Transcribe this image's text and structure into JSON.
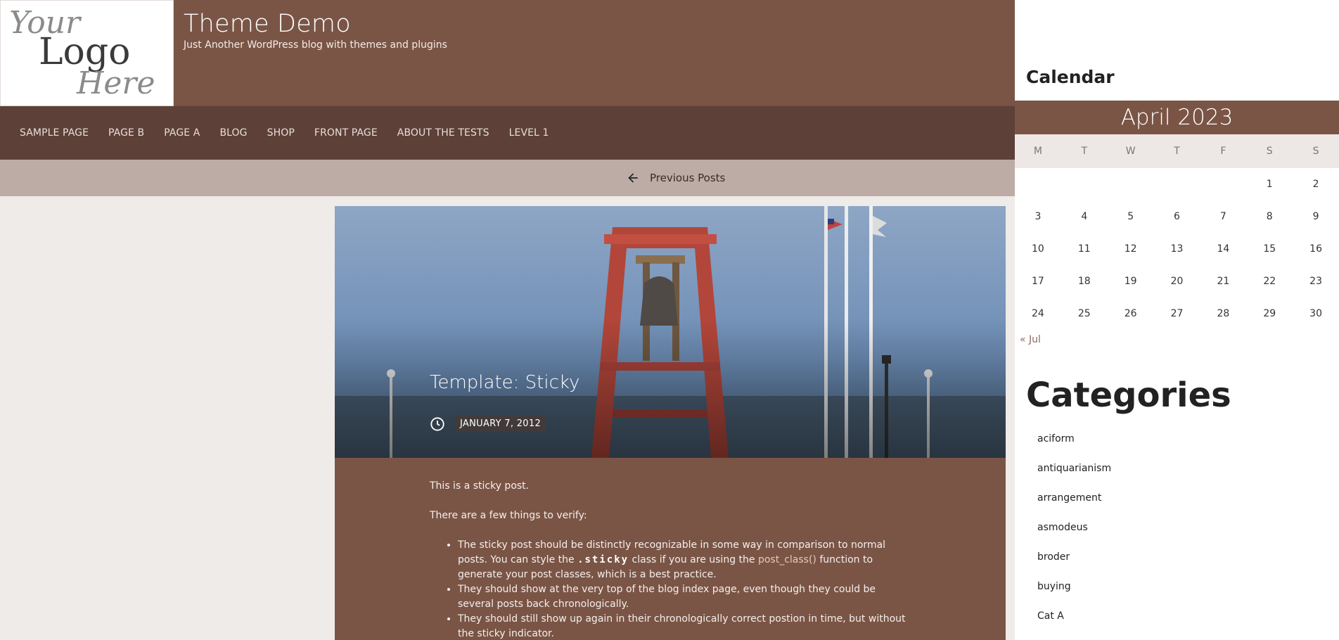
{
  "header": {
    "logo_lines": [
      "Your",
      "Logo",
      "Here"
    ],
    "site_title": "Theme Demo",
    "site_description": "Just Another WordPress blog with themes and plugins"
  },
  "nav": {
    "items": [
      "SAMPLE PAGE",
      "PAGE B",
      "PAGE A",
      "BLOG",
      "SHOP",
      "FRONT PAGE",
      "ABOUT THE TESTS",
      "LEVEL 1"
    ]
  },
  "pagination": {
    "previous_label": "Previous Posts"
  },
  "post": {
    "title": "Template: Sticky",
    "date": "JANUARY 7, 2012",
    "paragraphs": [
      "This is a sticky post.",
      "There are a few things to verify:"
    ],
    "list": {
      "item1_before": "The sticky post should be distinctly recognizable in some way in comparison to normal posts. You can style the ",
      "item1_code": ".sticky",
      "item1_middle": " class if you are using the ",
      "item1_link": "post_class()",
      "item1_after": " function to generate your post classes, which is a best practice.",
      "item2": "They should show at the very top of the blog index page, even though they could be several posts back chronologically.",
      "item3": "They should still show up again in their chronologically correct postion in time, but without the sticky indicator."
    }
  },
  "sidebar": {
    "calendar": {
      "title": "Calendar",
      "month": "April 2023",
      "weekdays": [
        "M",
        "T",
        "W",
        "T",
        "F",
        "S",
        "S"
      ],
      "weeks": [
        [
          "",
          "",
          "",
          "",
          "",
          "1",
          "2"
        ],
        [
          "3",
          "4",
          "5",
          "6",
          "7",
          "8",
          "9"
        ],
        [
          "10",
          "11",
          "12",
          "13",
          "14",
          "15",
          "16"
        ],
        [
          "17",
          "18",
          "19",
          "20",
          "21",
          "22",
          "23"
        ],
        [
          "24",
          "25",
          "26",
          "27",
          "28",
          "29",
          "30"
        ]
      ],
      "prev_link": "« Jul"
    },
    "categories": {
      "title": "Categories",
      "items": [
        "aciform",
        "antiquarianism",
        "arrangement",
        "asmodeus",
        "broder",
        "buying",
        "Cat A"
      ]
    }
  },
  "colors": {
    "brand_brown": "#7a5546",
    "nav_dark": "#5d4037",
    "pagination_bar": "#bcaca5",
    "page_background": "#efebe8"
  }
}
